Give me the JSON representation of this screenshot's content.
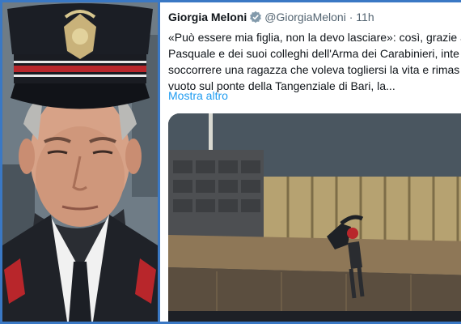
{
  "tweet": {
    "author_name": "Giorgia Meloni",
    "handle": "@GiorgiaMeloni",
    "separator": "·",
    "time": "11h",
    "text_lines": [
      "«Può essere mia figlia, non la devo lasciare»: così, grazie a",
      "Pasquale e dei suoi colleghi dell'Arma dei Carabinieri, inte",
      "soccorrere una ragazza che voleva togliersi la vita e rimas",
      "vuoto sul ponte della Tangenziale di Bari, la..."
    ],
    "show_more": "Mostra altro",
    "verified_icon": "verified-badge-icon",
    "link_color": "#1d9bf0"
  },
  "photo": {
    "subject": "carabiniere-portrait"
  },
  "media": {
    "subject": "bridge-rescue-photo"
  }
}
